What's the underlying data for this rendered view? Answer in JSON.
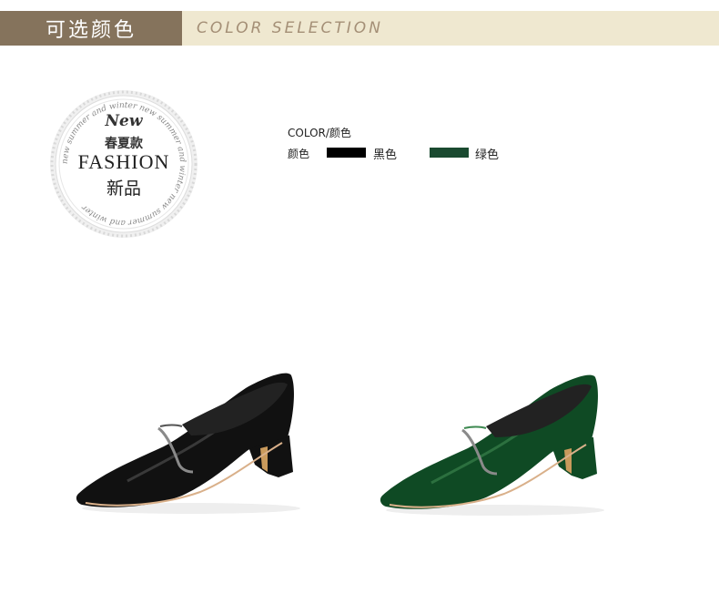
{
  "header": {
    "title_cn": "可选颜色",
    "title_en": "COLOR SELECTION"
  },
  "badge": {
    "new_label": "New",
    "season_cn": "春夏款",
    "fashion_label": "FASHION",
    "new_cn": "新品",
    "ring_text": "new summer and winter new summer and winter new summer and winter "
  },
  "color_spec": {
    "title": "COLOR/颜色",
    "label": "颜色",
    "options": [
      {
        "name": "黑色",
        "color": "#000000"
      },
      {
        "name": "绿色",
        "color": "#1a4a30"
      }
    ]
  },
  "products": [
    {
      "variant": "black",
      "body_color": "#111111",
      "highlight": "#555555"
    },
    {
      "variant": "green",
      "body_color": "#0f4a24",
      "highlight": "#3f8a52"
    }
  ]
}
